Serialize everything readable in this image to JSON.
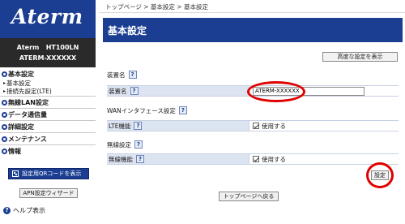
{
  "sidebar": {
    "logo": "Aterm",
    "model": "Aterm   HT100LN",
    "device_name": "ATERM-XXXXXX",
    "menu": [
      {
        "label": "基本設定",
        "subs": [
          "基本設定",
          "接続先設定(LTE)"
        ]
      },
      {
        "label": "無線LAN設定"
      },
      {
        "label": "データ通信量"
      },
      {
        "label": "詳細設定"
      },
      {
        "label": "メンテナンス"
      },
      {
        "label": "情報"
      }
    ],
    "qr_button": "設定用QRコードを表示",
    "apn_button": "APN設定ウィザード",
    "help": "ヘルプ表示"
  },
  "breadcrumb": "トップページ > 基本設定 > 基本設定",
  "header_title": "基本設定",
  "advanced_button": "高度な設定を表示",
  "sections": {
    "device_name": {
      "title": "装置名",
      "row_label": "装置名",
      "value": "ATERM-XXXXXX"
    },
    "wan": {
      "title": "WANインタフェース設定",
      "row_label": "LTE機能",
      "value": "使用する"
    },
    "wireless": {
      "title": "無線設定",
      "row_label": "無線機能",
      "value": "使用する"
    }
  },
  "help_mark": "?",
  "set_button": "設定",
  "top_button": "トップページへ戻る",
  "colors": {
    "brand": "#1b3e92",
    "annotation": "#e00000"
  }
}
